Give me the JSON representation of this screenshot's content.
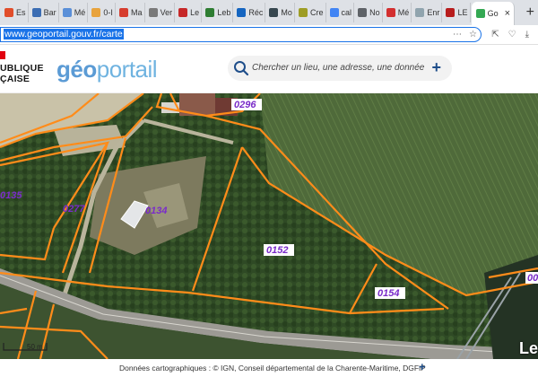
{
  "browser": {
    "tabs": [
      {
        "label": "Es",
        "color": "#e14d2a"
      },
      {
        "label": "Bar",
        "color": "#3b6db3"
      },
      {
        "label": "Mé",
        "color": "#5a8fd8"
      },
      {
        "label": "0-I",
        "color": "#e8a33d"
      },
      {
        "label": "Ma",
        "color": "#d63d2e"
      },
      {
        "label": "Ver",
        "color": "#7a7a7a"
      },
      {
        "label": "Le",
        "color": "#c62828"
      },
      {
        "label": "Leb",
        "color": "#2e7d32"
      },
      {
        "label": "Réc",
        "color": "#1565c0"
      },
      {
        "label": "Mo",
        "color": "#37474f"
      },
      {
        "label": "Cre",
        "color": "#9e9d24"
      },
      {
        "label": "cal",
        "color": "#4285f4"
      },
      {
        "label": "No",
        "color": "#5f6368"
      },
      {
        "label": "Mé",
        "color": "#d32f2f"
      },
      {
        "label": "Enr",
        "color": "#90a4ae"
      },
      {
        "label": "LE",
        "color": "#b71c1c"
      },
      {
        "label": "Go",
        "color": "#34a853"
      }
    ],
    "url": "www.geoportail.gouv.fr/carte"
  },
  "header": {
    "republique_line1": "UBLIQUE",
    "republique_line2": "ÇAISE",
    "logo_first": "géo",
    "logo_rest": "portail",
    "search_placeholder": "Chercher un lieu, une adresse, une donnée",
    "add_symbol": "+"
  },
  "map": {
    "parcels": [
      "0296",
      "0135",
      "0277",
      "0134",
      "0152",
      "0154",
      "00"
    ],
    "scale_label": "50 m",
    "leaflet_text": "Le"
  },
  "attribution": {
    "prefix": "Données cartographiques : ©",
    "sources": "IGN, Conseil départemental de la Charente-Maritime, DGFiP",
    "plus": "+"
  },
  "colors": {
    "parcel_line": "#ff8c1a",
    "parcel_label": "#7a2cc9",
    "accent": "#1a73e8"
  }
}
